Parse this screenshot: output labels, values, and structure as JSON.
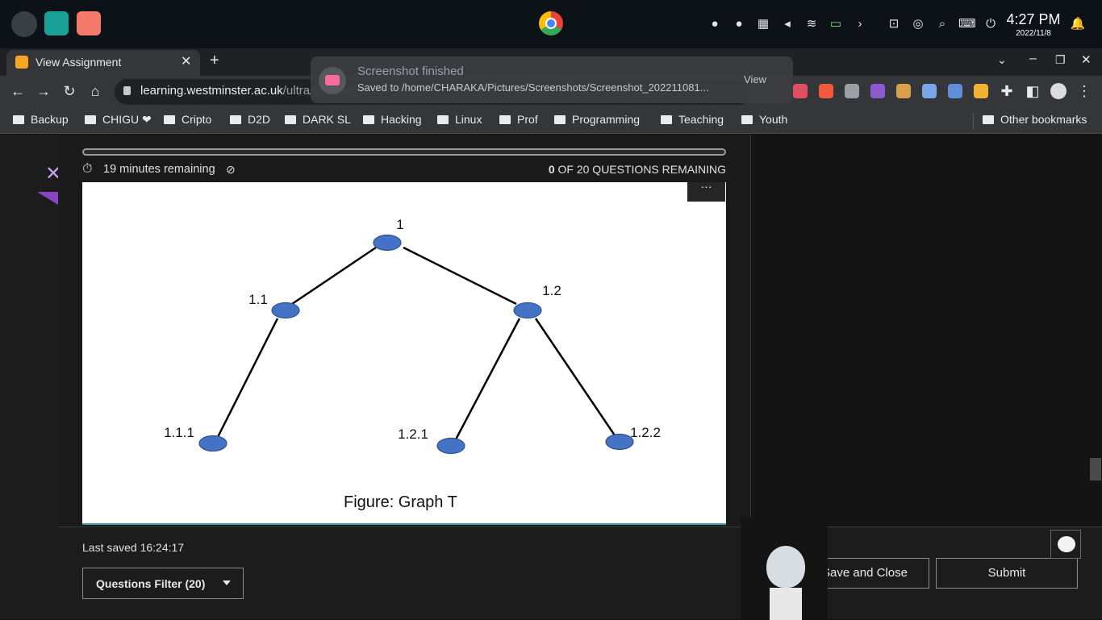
{
  "os": {
    "clock_time": "4:27 PM",
    "clock_date": "2022/11/8"
  },
  "browser": {
    "tab_title": "View Assignment",
    "url_host": "learning.westminster.ac.uk",
    "url_path": "/ultra/courses/...",
    "bookmarks": [
      "Backup",
      "CHIGU ❤",
      "Cripto",
      "D2D",
      "DARK SL",
      "Hacking",
      "Linux",
      "Prof",
      "Programming",
      "Teaching",
      "Youth"
    ],
    "other_bookmarks": "Other bookmarks"
  },
  "toast": {
    "title": "Screenshot finished",
    "message": "Saved to /home/CHARAKA/Pictures/Screenshots/Screenshot_202211081...",
    "action": "View"
  },
  "assessment": {
    "timer": "19 minutes remaining",
    "questions_count": "0",
    "questions_text": "OF 20 QUESTIONS REMAINING",
    "more": "···",
    "figure_caption": "Figure: Graph T",
    "last_saved": "Last saved 16:24:17",
    "filter_label": "Questions Filter (20)",
    "save_close": "Save and Close",
    "submit": "Submit"
  },
  "graph": {
    "nodes": [
      {
        "id": "1",
        "label": "1"
      },
      {
        "id": "1.1",
        "label": "1.1"
      },
      {
        "id": "1.2",
        "label": "1.2"
      },
      {
        "id": "1.1.1",
        "label": "1.1.1"
      },
      {
        "id": "1.2.1",
        "label": "1.2.1"
      },
      {
        "id": "1.2.2",
        "label": "1.2.2"
      }
    ],
    "edges": [
      [
        "1",
        "1.1"
      ],
      [
        "1",
        "1.2"
      ],
      [
        "1.1",
        "1.1.1"
      ],
      [
        "1.2",
        "1.2.1"
      ],
      [
        "1.2",
        "1.2.2"
      ]
    ],
    "node_color": "#4472c4"
  }
}
